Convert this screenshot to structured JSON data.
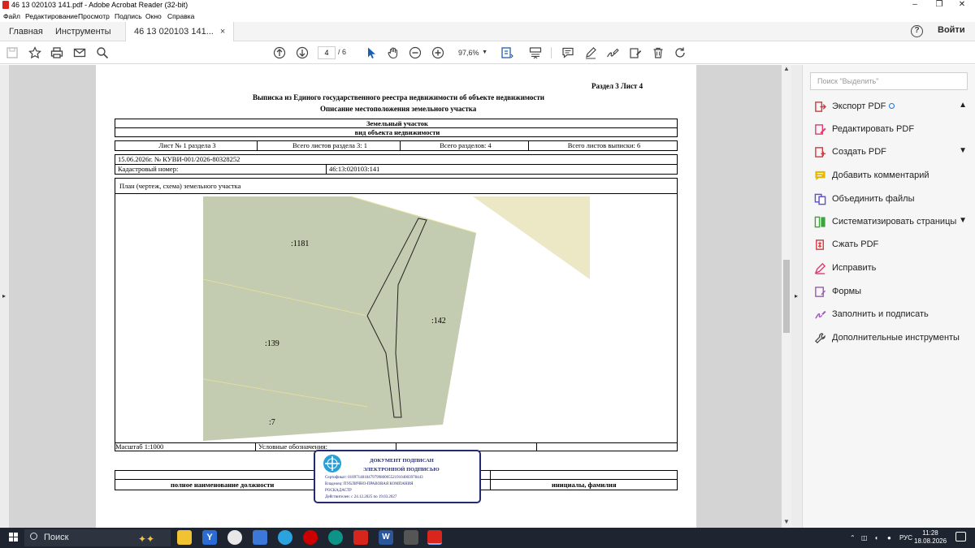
{
  "window": {
    "title": "46 13 020103 141.pdf - Adobe Acrobat Reader (32-bit)",
    "minimize": "–",
    "restore": "❐",
    "close": "✕"
  },
  "menu": [
    "Файл",
    "Редактирование",
    "Просмотр",
    "Подпись",
    "Окно",
    "Справка"
  ],
  "tabs": {
    "home": "Главная",
    "tools": "Инструменты",
    "doc": "46 13 020103 141...",
    "doc_close": "×",
    "help": "?",
    "signin": "Войти"
  },
  "toolbar": {
    "page_current": "4",
    "page_total": "/ 6",
    "zoom": "97,6%"
  },
  "document": {
    "header_section": "Раздел 3    Лист 4",
    "title_line1": "Выписка из Единого государственного реестра недвижимости об объекте недвижимости",
    "title_line2": "Описание местоположения земельного участка",
    "object_type": "Земельный участок",
    "object_type_caption": "вид объекта недвижимости",
    "sheet_no": "Лист № 1 раздела 3",
    "total_sheets_section": "Всего листов раздела 3: 1",
    "total_sections": "Всего разделов: 4",
    "total_sheets_extract": "Всего листов выписки: 6",
    "date_number": "15.06.2026г. № КУВИ-001/2026-80328252",
    "cadastral_label": "Кадастровый номер:",
    "cadastral_value": "46:13:020103:141",
    "plan_title": "План (чертеж, схема) земельного участка",
    "parcel_labels": {
      "p1181": ":1181",
      "p142": ":142",
      "p139": ":139",
      "p7": ":7"
    },
    "scale": "Масштаб 1:1000",
    "legend": "Условные обозначения:",
    "position_caption": "полное наименование должности",
    "initials_caption": "инициалы, фамилия"
  },
  "stamp": {
    "line1": "ДОКУМЕНТ ПОДПИСАН",
    "line2": "ЭЛЕКТРОННОЙ ПОДПИСЬЮ",
    "cert": "Сертификат: 0109714818479799800055219104003978443",
    "owner1": "Владелец: ПУБЛИЧНО-ПРАВОВАЯ КОМПАНИЯ",
    "owner2": "РОСКАДАСТР",
    "valid": "Действителен: с 24.12.2025 по 19.03.2027"
  },
  "sidepanel": {
    "search_placeholder": "Поиск \"Выделить\"",
    "tools": [
      {
        "label": "Экспорт PDF",
        "icon": "export-pdf-icon",
        "color": "#d7373f"
      },
      {
        "label": "Редактировать PDF",
        "icon": "edit-pdf-icon",
        "color": "#e03c6c"
      },
      {
        "label": "Создать PDF",
        "icon": "create-pdf-icon",
        "color": "#d7373f"
      },
      {
        "label": "Добавить комментарий",
        "icon": "comment-icon",
        "color": "#e8b800"
      },
      {
        "label": "Объединить файлы",
        "icon": "combine-files-icon",
        "color": "#5a4fcf"
      },
      {
        "label": "Систематизировать страницы",
        "icon": "organize-pages-icon",
        "color": "#3aa53a"
      },
      {
        "label": "Сжать PDF",
        "icon": "compress-pdf-icon",
        "color": "#d7373f"
      },
      {
        "label": "Исправить",
        "icon": "redact-icon",
        "color": "#e03c6c"
      },
      {
        "label": "Формы",
        "icon": "forms-icon",
        "color": "#9b59b6"
      },
      {
        "label": "Заполнить и подписать",
        "icon": "fill-sign-icon",
        "color": "#9b59b6"
      },
      {
        "label": "Дополнительные инструменты",
        "icon": "more-tools-icon",
        "color": "#444444"
      }
    ]
  },
  "taskbar": {
    "search": "Поиск",
    "lang": "РУС",
    "time": "11:28",
    "date": "18.08.2026"
  },
  "colors": {
    "parcel_green": "#c3cbb0",
    "parcel_beige": "#ece8c6",
    "stamp_blue": "#232a6e",
    "acrobat_red": "#d9261c"
  }
}
